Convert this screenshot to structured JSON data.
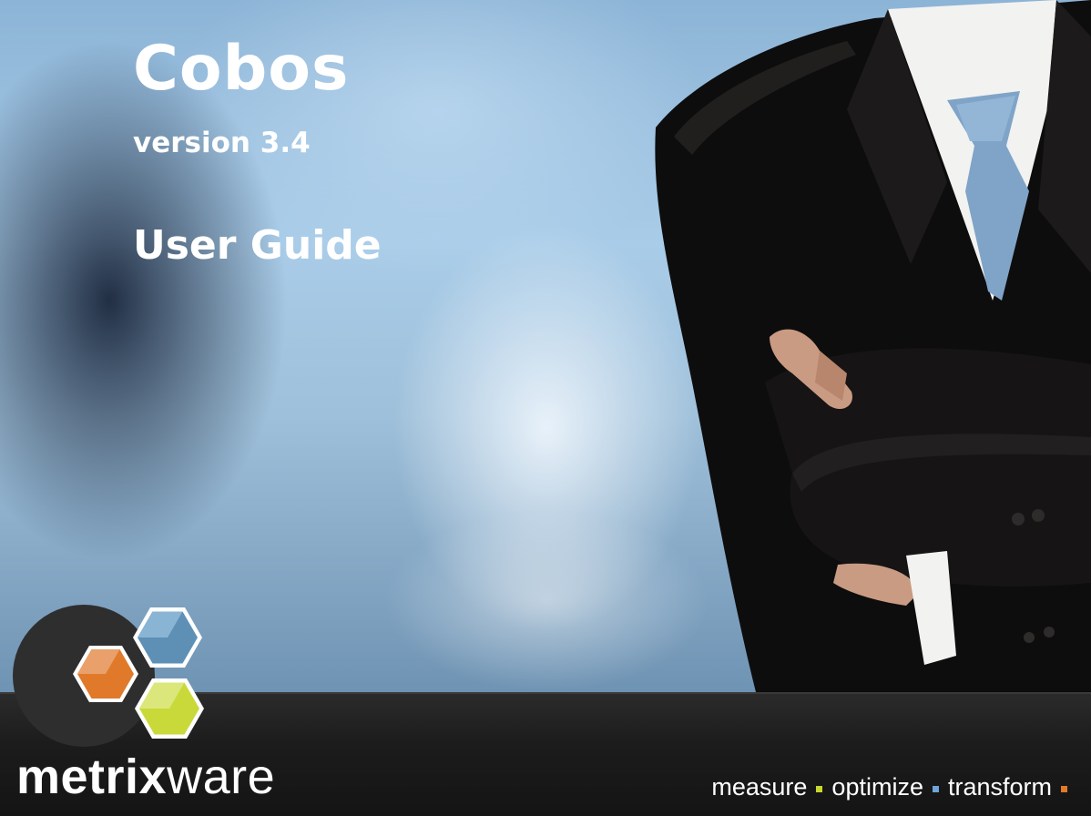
{
  "cover": {
    "title": "Cobos",
    "version": "version 3.4",
    "subtitle": "User Guide"
  },
  "brand": {
    "name_part1": "metrix",
    "name_part2": "ware",
    "logo_icon": "hexagon-cluster-logo",
    "logo_colors": {
      "orange": "#e07a2a",
      "blue": "#5e90b6",
      "green": "#c9d93a",
      "circle": "#2e2e2e"
    }
  },
  "tagline": {
    "word1": "measure",
    "word2": "optimize",
    "word3": "transform",
    "dot_colors": [
      "#c7d82e",
      "#6ea6d8",
      "#e07a2a"
    ]
  }
}
